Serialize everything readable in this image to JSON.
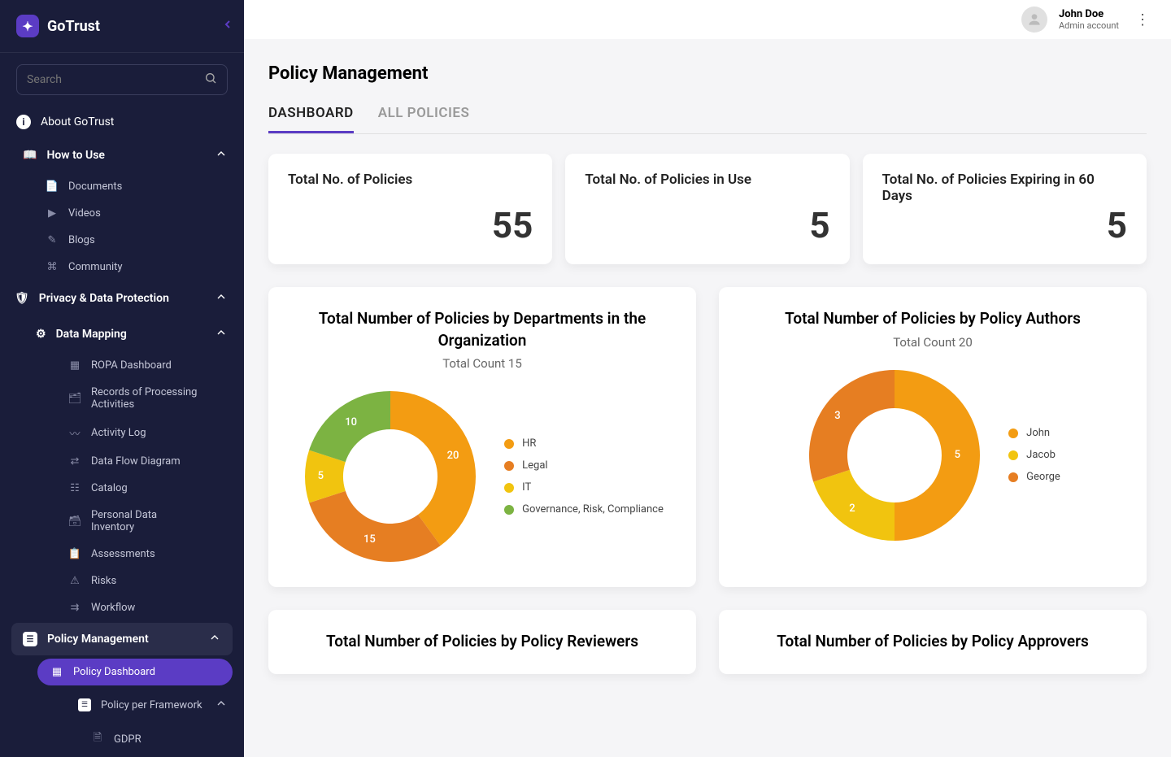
{
  "brand": "GoTrust",
  "search": {
    "placeholder": "Search"
  },
  "nav": {
    "about": "About GoTrust",
    "howToUse": "How to Use",
    "howToUseItems": [
      "Documents",
      "Videos",
      "Blogs",
      "Community"
    ],
    "privacySection": "Privacy & Data Protection",
    "dataMapping": "Data  Mapping",
    "dataMappingItems": [
      "ROPA Dashboard",
      "Records of Processing Activities",
      "Activity Log",
      "Data Flow Diagram",
      "Catalog",
      "Personal Data Inventory",
      "Assessments",
      "Risks",
      "Workflow"
    ],
    "policyMgmt": "Policy Management",
    "policyDashboard": "Policy Dashboard",
    "policyFramework": "Policy per Framework",
    "gdpr": "GDPR"
  },
  "user": {
    "name": "John Doe",
    "role": "Admin account"
  },
  "page": {
    "title": "Policy Management",
    "tabs": [
      "DASHBOARD",
      "ALL POLICIES"
    ]
  },
  "stats": [
    {
      "label": "Total No. of Policies",
      "value": "55"
    },
    {
      "label": "Total No. of Policies in Use",
      "value": "5"
    },
    {
      "label": "Total No. of Policies Expiring in 60 Days",
      "value": "5"
    }
  ],
  "chart_data": [
    {
      "type": "pie",
      "title": "Total Number of Policies by Departments in the Organization",
      "subtitle": "Total Count 15",
      "series": [
        {
          "name": "HR",
          "value": 20,
          "color": "#f39c12"
        },
        {
          "name": "Legal",
          "value": 15,
          "color": "#e67e22"
        },
        {
          "name": "IT",
          "value": 5,
          "color": "#f1c40f"
        },
        {
          "name": "Governance, Risk, Compliance",
          "value": 10,
          "color": "#7cb342"
        }
      ]
    },
    {
      "type": "pie",
      "title": "Total Number of Policies by Policy Authors",
      "subtitle": "Total Count 20",
      "series": [
        {
          "name": "John",
          "value": 5,
          "color": "#f39c12"
        },
        {
          "name": "Jacob",
          "value": 2,
          "color": "#f1c40f"
        },
        {
          "name": "George",
          "value": 3,
          "color": "#e67e22"
        }
      ]
    },
    {
      "type": "pie",
      "title": "Total Number of Policies by Policy Reviewers",
      "subtitle": "",
      "series": []
    },
    {
      "type": "pie",
      "title": "Total Number of Policies by Policy Approvers",
      "subtitle": "",
      "series": []
    }
  ]
}
